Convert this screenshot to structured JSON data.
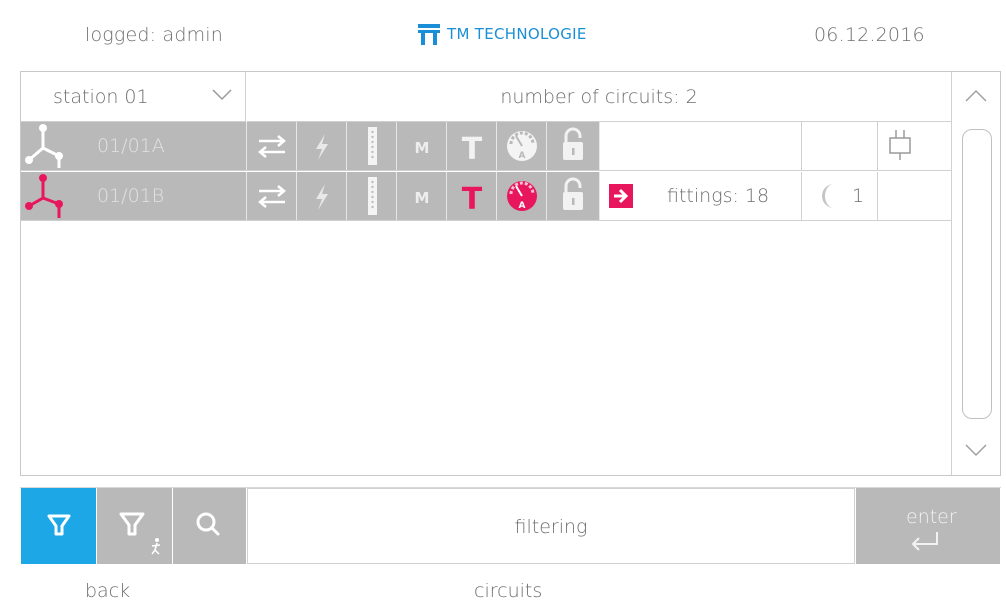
{
  "header": {
    "logged_user": "logged: admin",
    "logo_text": "TM TECHNOLOGIE",
    "date": "06.12.2016"
  },
  "toolbar": {
    "station_select": "station 01",
    "number_of_circuits": "number of circuits: 2"
  },
  "circuits": [
    {
      "id": "01/01A",
      "active": false,
      "extra": "",
      "moon": "",
      "icons": [
        "swap-icon",
        "bolt-icon",
        "meter-bar-icon",
        "m-icon",
        "t-icon",
        "gauge-icon",
        "lock-icon"
      ],
      "plug": true
    },
    {
      "id": "01/01B",
      "active": true,
      "extra": "fittings: 18",
      "moon": "1",
      "icons": [
        "swap-icon",
        "bolt-icon",
        "meter-bar-icon",
        "m-icon",
        "t-icon",
        "gauge-icon",
        "lock-icon"
      ],
      "plug": false
    }
  ],
  "filter": {
    "placeholder": "filtering",
    "enter_label": "enter"
  },
  "footer": {
    "back": "back",
    "screen": "circuits"
  },
  "colors": {
    "accent": "#1ea7e6",
    "active": "#e8175d",
    "gray": "#b9b9b9"
  }
}
